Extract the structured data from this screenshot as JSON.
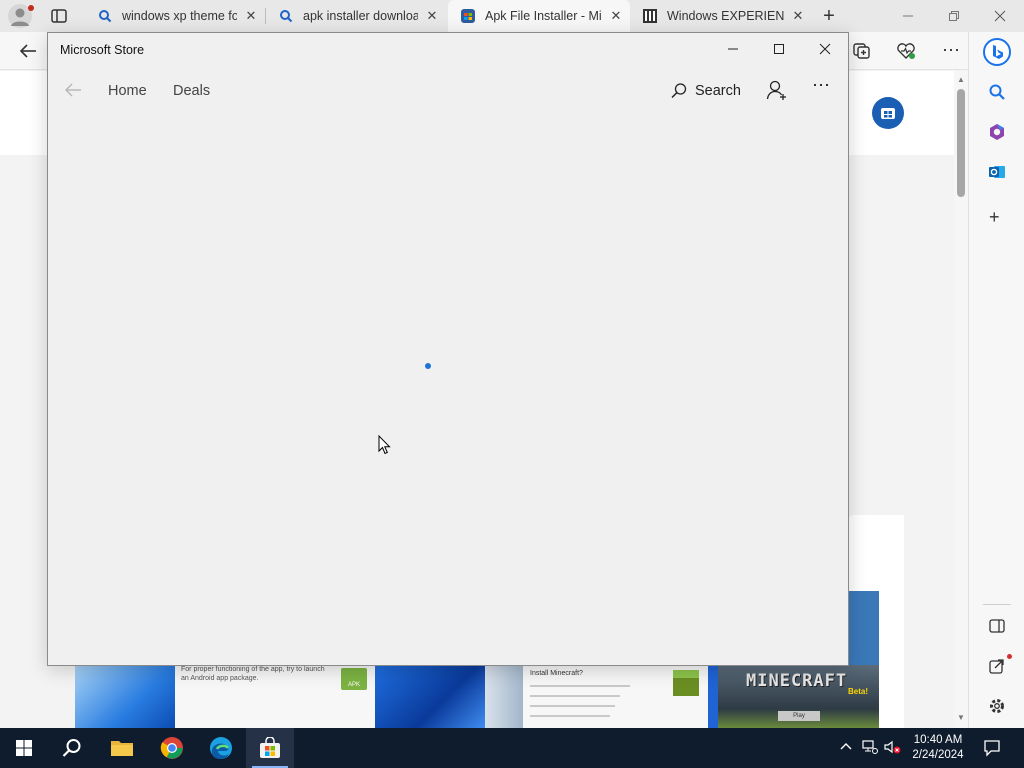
{
  "browser": {
    "tabs": [
      {
        "title": "windows xp theme fo",
        "icon": "search-icon"
      },
      {
        "title": "apk installer downloa",
        "icon": "search-icon"
      },
      {
        "title": "Apk File Installer - Mic",
        "icon": "store-icon"
      },
      {
        "title": "Windows EXPERIENCE",
        "icon": "site-icon"
      }
    ],
    "active_tab_index": 2
  },
  "store": {
    "window_title": "Microsoft Store",
    "nav": {
      "home": "Home",
      "deals": "Deals",
      "search": "Search"
    },
    "loading": true,
    "accent_color": "#1b74d3"
  },
  "page_thumbs": {
    "text_1": "For proper functioning of the app, try to launch an Android app package.",
    "apk_badge": "APK",
    "install_title": "Install Minecraft?",
    "minecraft": "MINECRAFT",
    "beta": "Beta!",
    "play": "Play"
  },
  "taskbar": {
    "time": "10:40 AM",
    "date": "2/24/2024"
  }
}
